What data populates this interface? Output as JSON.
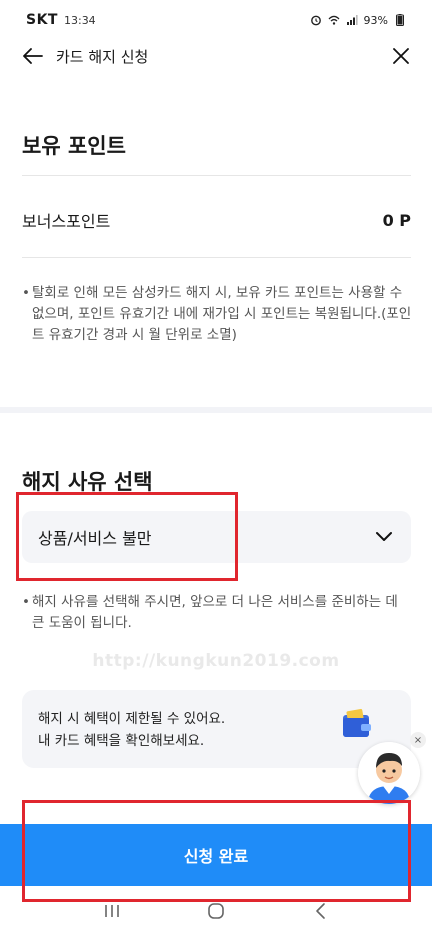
{
  "status_bar": {
    "carrier": "SKT",
    "time": "13:34",
    "battery": "93%"
  },
  "header": {
    "title": "카드 해지 신청",
    "back_icon": "arrow-left-icon",
    "close_icon": "close-icon"
  },
  "points": {
    "title": "보유 포인트",
    "bonus_label": "보너스포인트",
    "bonus_value": "0 P",
    "note": "탈회로 인해 모든 삼성카드 해지 시, 보유 카드 포인트는 사용할 수 없으며, 포인트 유효기간 내에 재가입 시 포인트는 복원됩니다.(포인트 유효기간 경과 시 월 단위로 소멸)"
  },
  "reason": {
    "title": "해지 사유 선택",
    "selected": "상품/서비스 불만",
    "dropdown_icon": "chevron-down-icon",
    "note": "해지 사유를 선택해 주시면, 앞으로 더 나은 서비스를 준비하는 데 큰 도움이 됩니다."
  },
  "watermark": "http://kungkun2019.com",
  "benefit_banner": {
    "line1": "해지 시 혜택이 제한될 수 있어요.",
    "line2": "내 카드 혜택을 확인해보세요.",
    "icon": "wallet-icon"
  },
  "chatbot": {
    "icon": "chatbot-avatar-icon",
    "close": "×"
  },
  "submit_label": "신청 완료",
  "nav_bar": {
    "recent_icon": "recent-apps-icon",
    "home_icon": "home-icon",
    "back_icon": "nav-back-icon"
  },
  "colors": {
    "accent": "#1f8cf8",
    "annotation": "#e0262e",
    "field_bg": "#f4f5f8"
  }
}
